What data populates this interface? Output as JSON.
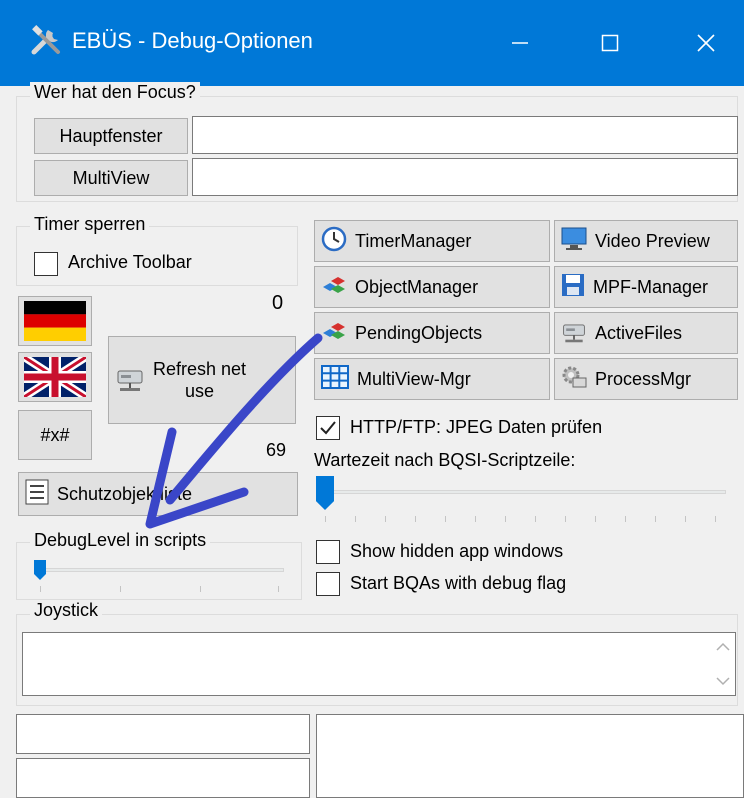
{
  "window": {
    "title": "EBÜS - Debug-Optionen",
    "icon": "tools-icon",
    "controls": {
      "minimize": "minimize-icon",
      "maximize": "maximize-icon",
      "close": "close-icon"
    }
  },
  "focus_group": {
    "legend": "Wer hat den Focus?",
    "rows": [
      {
        "button": "Hauptfenster",
        "value": ""
      },
      {
        "button": "MultiView",
        "value": ""
      }
    ]
  },
  "timer_group": {
    "legend": "Timer sperren",
    "archive_toolbar": {
      "label": "Archive Toolbar",
      "checked": false
    }
  },
  "counters": {
    "top": "0",
    "bottom": "69"
  },
  "buttons": {
    "hash": "#x#",
    "refresh_line1": "Refresh net",
    "refresh_line2": "use",
    "schutzobjekte": "Schutzobjektliste",
    "timer_manager": "TimerManager",
    "video_preview": "Video Preview",
    "object_manager": "ObjectManager",
    "mpf_manager": "MPF-Manager",
    "pending_objects": "PendingObjects",
    "active_files": "ActiveFiles",
    "multiview_mgr": "MultiView-Mgr",
    "process_mgr": "ProcessMgr"
  },
  "http_check": {
    "label": "HTTP/FTP: JPEG Daten prüfen",
    "checked": true
  },
  "wartezeit": {
    "label": "Wartezeit nach BQSI-Scriptzeile:",
    "value_fraction": 0.0
  },
  "debuglevel": {
    "legend": "DebugLevel in scripts",
    "value_fraction": 0.0
  },
  "show_hidden": {
    "label": "Show hidden app windows",
    "checked": false
  },
  "start_bqas": {
    "label": "Start BQAs with debug flag",
    "checked": false
  },
  "joystick": {
    "legend": "Joystick",
    "value": ""
  },
  "colors": {
    "titlebar": "#0078d7",
    "annotation_arrow": "#3a46c8",
    "thumb": "#0078d7"
  }
}
